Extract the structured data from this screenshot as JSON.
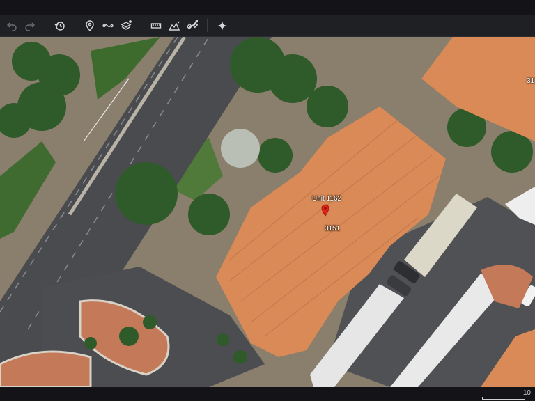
{
  "toolbar": {
    "buttons": [
      {
        "name": "undo-icon"
      },
      {
        "name": "redo-icon"
      },
      {
        "name": "history-icon"
      },
      {
        "name": "add-placemark-icon"
      },
      {
        "name": "add-path-icon"
      },
      {
        "name": "layers-icon"
      },
      {
        "name": "ruler-icon"
      },
      {
        "name": "elevation-icon"
      },
      {
        "name": "satellite-icon"
      },
      {
        "name": "sparkle-icon"
      }
    ]
  },
  "map": {
    "labels": {
      "unit": "Unit 1162",
      "building_number": "3151",
      "edge_number": "315"
    },
    "pin_color": "#e2231a"
  },
  "scale": {
    "label": "10"
  },
  "colors": {
    "roof": "#d98a57",
    "asphalt": "#4a4b4e",
    "grass": "#4f7a3a",
    "tree": "#2f5a2a"
  }
}
